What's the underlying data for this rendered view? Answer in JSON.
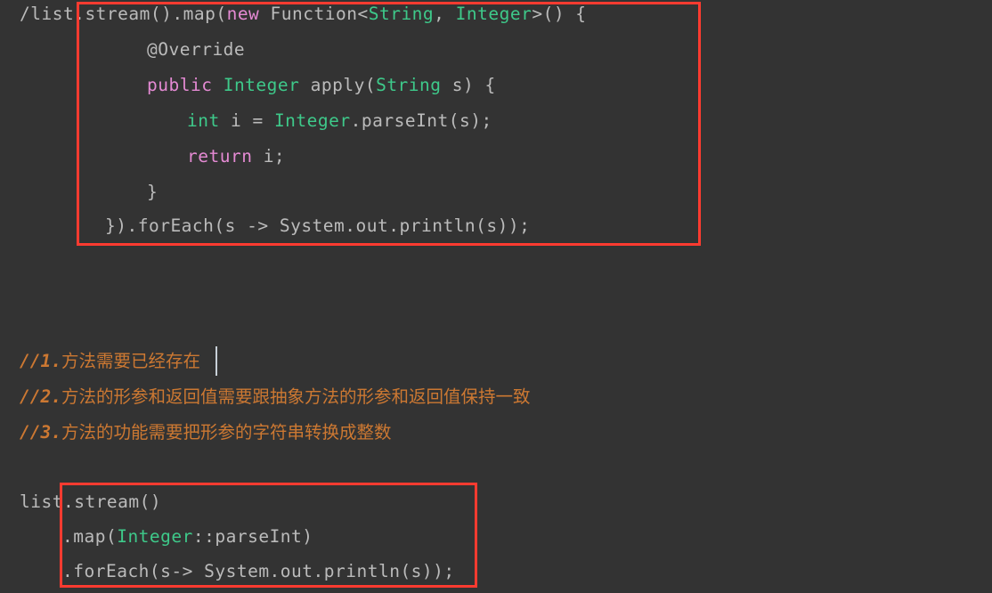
{
  "editor": {
    "background_color": "#333333",
    "default_text_color": "#bbbbbb",
    "keyword_color": "#e48ad3",
    "type_color": "#3ec98a",
    "comment_color": "#cc7832",
    "highlight_box_color": "#ff3b30"
  },
  "code_top": {
    "line1_prefix": "/list",
    "line1_a": ".stream().map(",
    "line1_new": "new",
    "line1_b": " Function<",
    "line1_string": "String",
    "line1_c": ", ",
    "line1_integer": "Integer",
    "line1_d": ">() {",
    "line2_override": "@Override",
    "line3_public": "public",
    "line3_a": " ",
    "line3_integer": "Integer",
    "line3_b": " apply(",
    "line3_string": "String",
    "line3_c": " s) {",
    "line4_int": "int",
    "line4_a": " i = ",
    "line4_integer": "Integer",
    "line4_b": ".parseInt(s);",
    "line5_return": "return",
    "line5_a": " i;",
    "line6_brace": "}",
    "line7": "}).forEach(s -> System.out.println(s));"
  },
  "comments": [
    {
      "slashes": "//",
      "number": "1.",
      "text": "方法需要已经存在"
    },
    {
      "slashes": "//",
      "number": "2.",
      "text": "方法的形参和返回值需要跟抽象方法的形参和返回值保持一致"
    },
    {
      "slashes": "//",
      "number": "3.",
      "text": "方法的功能需要把形参的字符串转换成整数"
    }
  ],
  "code_bottom": {
    "line1_prefix": "list",
    "line1_a": ".stream()",
    "line2_a": ".map(",
    "line2_integer": "Integer",
    "line2_b": "::parseInt)",
    "line3": ".forEach(s-> System.out.println(s));"
  }
}
